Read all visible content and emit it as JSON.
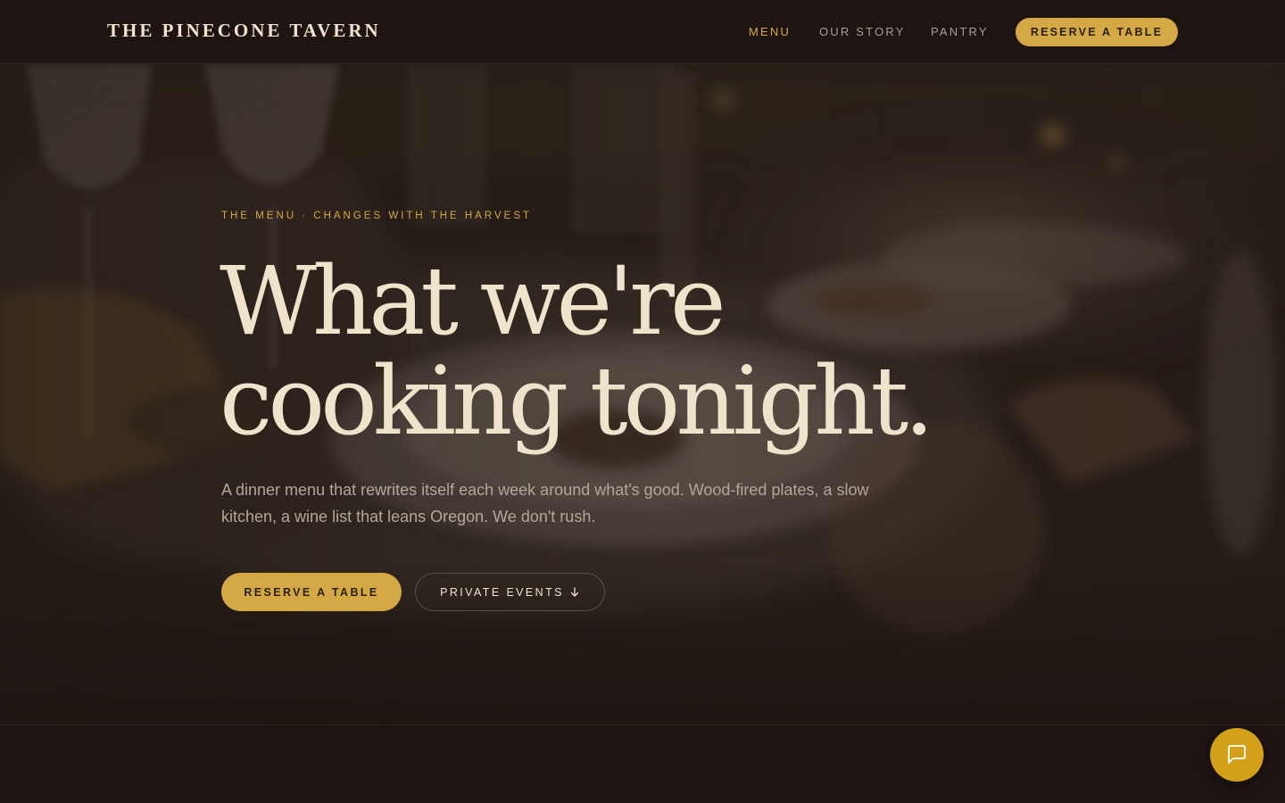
{
  "header": {
    "brand": "THE PINECONE TAVERN",
    "nav": [
      {
        "label": "MENU",
        "active": true
      },
      {
        "label": "OUR STORY",
        "active": false
      },
      {
        "label": "PANTRY",
        "active": false
      }
    ],
    "reserve_label": "RESERVE A TABLE"
  },
  "hero": {
    "eyebrow": "THE MENU · CHANGES WITH THE HARVEST",
    "headline_line1": "What we're",
    "headline_line2": "cooking tonight.",
    "lead": "A dinner menu that rewrites itself each week around what's good. Wood-fired plates, a slow kitchen, a wine list that leans Oregon. We don't rush.",
    "primary_button": "RESERVE A TABLE",
    "secondary_button": "PRIVATE EVENTS",
    "secondary_icon": "arrow-down-icon"
  },
  "chat": {
    "icon": "chat-icon"
  },
  "colors": {
    "background": "#1e1512",
    "accent": "#d4a945",
    "headline": "#efe3cc",
    "body_text": "#b3a79a",
    "nav_text": "#a89e92",
    "chat_button": "#d4a017"
  }
}
